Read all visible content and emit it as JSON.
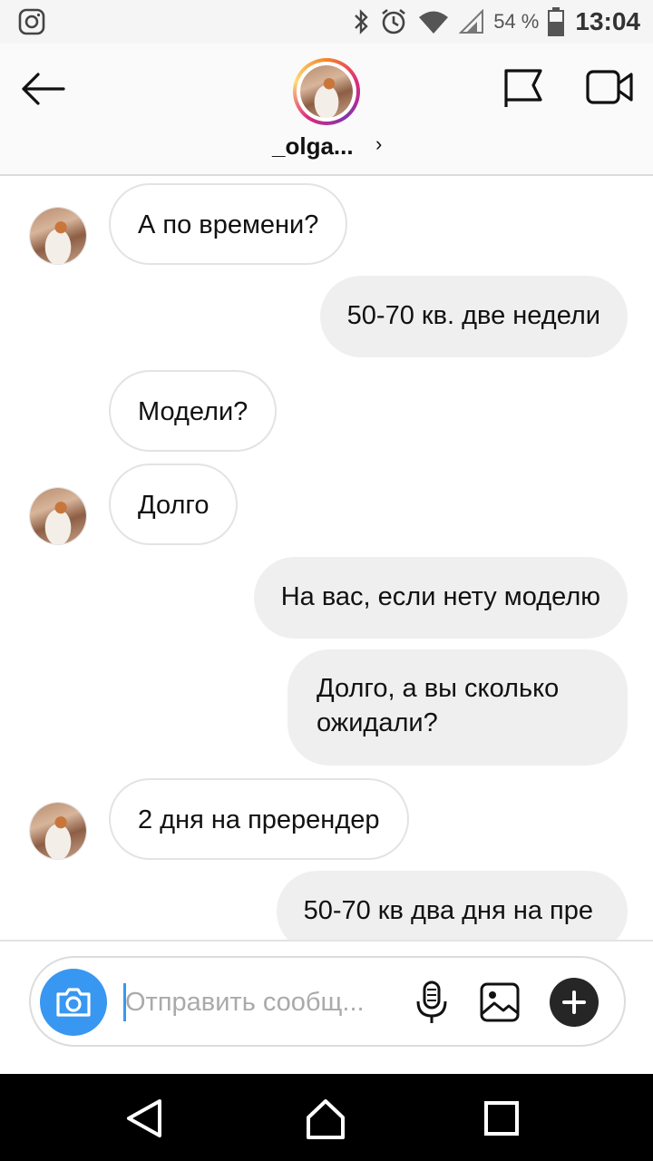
{
  "status_bar": {
    "battery": "54 %",
    "time": "13:04",
    "icons": [
      "instagram-icon",
      "bluetooth-icon",
      "alarm-icon",
      "wifi-icon",
      "signal-icon",
      "battery-icon"
    ]
  },
  "header": {
    "username": "_olga...",
    "chevron": "›",
    "icons": [
      "back-arrow-icon",
      "flag-icon",
      "video-call-icon"
    ]
  },
  "messages": [
    {
      "side": "in",
      "text": "А по времени?",
      "avatar": true
    },
    {
      "side": "out",
      "text": "50-70 кв. две недели"
    },
    {
      "side": "in",
      "text": "Модели?",
      "avatar": false
    },
    {
      "side": "in",
      "text": "Долго",
      "avatar": true
    },
    {
      "side": "out",
      "text": "На вас, если нету моделю"
    },
    {
      "side": "out",
      "text": "Долго, а вы сколько ожидали?"
    },
    {
      "side": "in",
      "text": "2 дня на пререндер",
      "avatar": true
    },
    {
      "side": "out",
      "text": "50-70 кв два дня на пре"
    }
  ],
  "composer": {
    "placeholder": "Отправить сообщ...",
    "icons": [
      "camera-icon",
      "microphone-icon",
      "gallery-icon",
      "plus-icon"
    ]
  },
  "colors": {
    "accent": "#3897f0",
    "outgoing_bubble": "#efefef",
    "incoming_border": "#e3e3e3"
  }
}
